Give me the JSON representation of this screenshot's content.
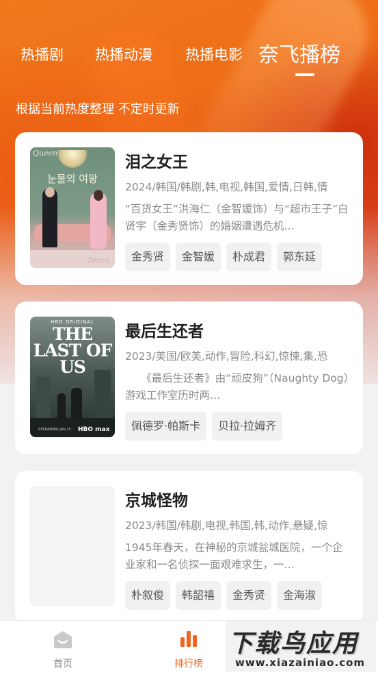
{
  "tabs": [
    {
      "label": "热播剧",
      "active": false
    },
    {
      "label": "热播动漫",
      "active": false
    },
    {
      "label": "热播电影",
      "active": false
    },
    {
      "label": "奈飞播榜",
      "active": true
    }
  ],
  "subtitle": "根据当前热度整理 不定时更新",
  "items": [
    {
      "title": "泪之女王",
      "meta": "2024/韩国/韩剧,韩,电视,韩国,爱情,日韩,情",
      "desc": "“百货女王”洪海仁（金智媛饰）与“超市王子”白贤宇（金秀贤饰）的婚姻遭遇危机…",
      "actors": [
        "金秀贤",
        "金智媛",
        "朴成君",
        "郭东延"
      ],
      "poster": {
        "script": "Queen",
        "kor": "눈물의 여왕",
        "signature": "Tears"
      }
    },
    {
      "title": "最后生还者",
      "meta": "2023/美国/欧美,动作,冒险,科幻,惊悚,集,恐",
      "desc": "　　《最后生还者》由“顽皮狗”（Naughty Dog）游戏工作室历时两…",
      "actors": [
        "佩德罗·帕斯卡",
        "贝拉·拉姆齐"
      ],
      "poster": {
        "top": "HBO ORIGINAL",
        "logo": "THE LAST OF US",
        "bottom": "HBO max",
        "small": "STREAMING JAN 15"
      }
    },
    {
      "title": "京城怪物",
      "meta": "2023/韩国/韩剧,电视,韩国,韩,动作,悬疑,惊",
      "desc": "1945年春天，在神秘的京城瓮城医院，一个企业家和一名侦探一面艰难求生，一…",
      "actors": [
        "朴叙俊",
        "韩韶禧",
        "金秀贤",
        "金海淑"
      ]
    }
  ],
  "bottom_nav": [
    {
      "label": "首页",
      "icon": "home-icon",
      "active": false
    },
    {
      "label": "排行榜",
      "icon": "ranking-icon",
      "active": true
    }
  ],
  "watermark": {
    "main": "下载鸟应用",
    "url": "www.xiazainiao.com"
  },
  "colors": {
    "accent": "#f0641e",
    "hero": "#ee6d16"
  }
}
